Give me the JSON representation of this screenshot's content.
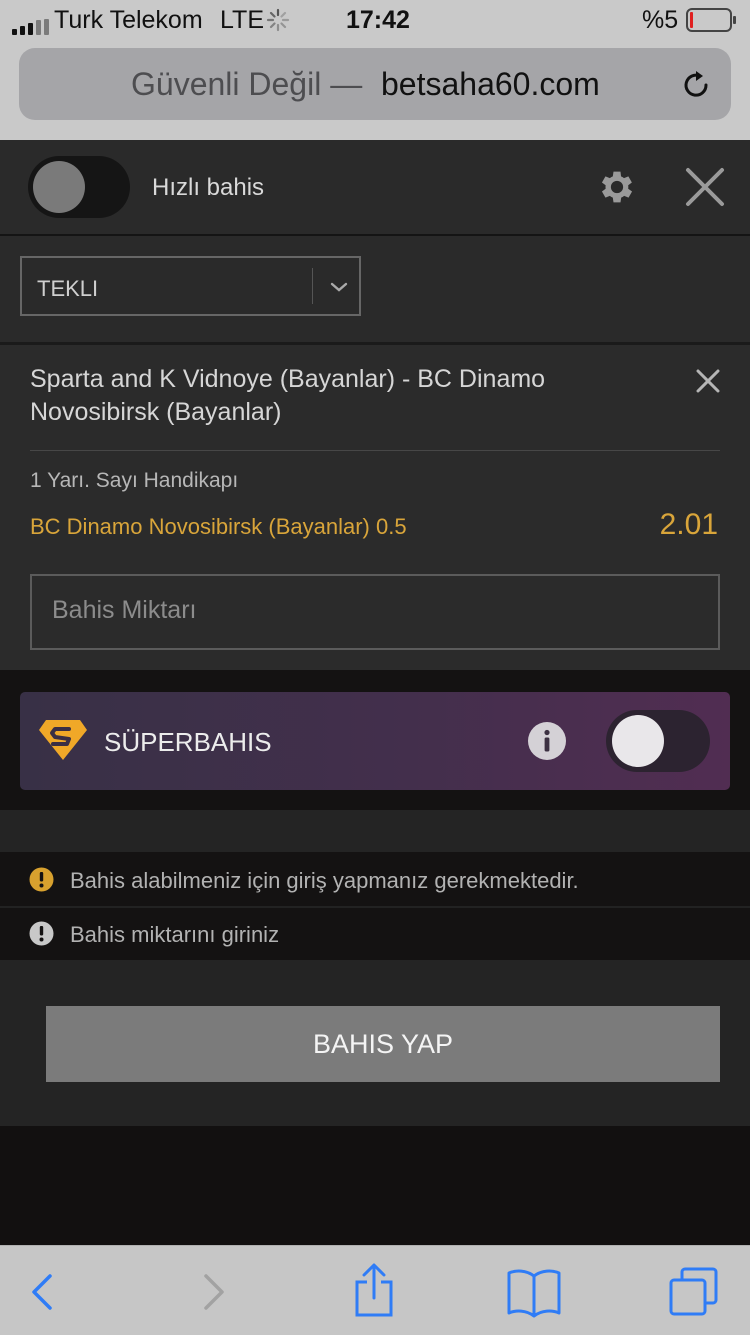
{
  "status_bar": {
    "carrier": "Turk Telekom",
    "network": "LTE",
    "time": "17:42",
    "battery": "%5"
  },
  "browser": {
    "security": "Güvenli Değil —",
    "domain": "betsaha60.com"
  },
  "header": {
    "quick_bet_label": "Hızlı bahis",
    "quick_bet_on": false
  },
  "bet_type": {
    "selected": "TEKLI"
  },
  "bet": {
    "match": "Sparta and K Vidnoye (Bayanlar) - BC Dinamo Novosibirsk (Bayanlar)",
    "market": "1 Yarı. Sayı Handikapı",
    "selection": "BC Dinamo Novosibirsk (Bayanlar) 0.5",
    "odds": "2.01",
    "amount_placeholder": "Bahis Miktarı"
  },
  "superbahis": {
    "label": "SÜPERBAHIS",
    "enabled": false
  },
  "messages": [
    "Bahis alabilmeniz için giriş yapmanız gerekmektedir.",
    "Bahis miktarını giriniz"
  ],
  "place_bet_label": "BAHIS YAP",
  "colors": {
    "accent_gold": "#d9a53a",
    "warning_yellow": "#d8a12e",
    "super_start": "#383046",
    "super_end": "#512d52",
    "ios_blue": "#2f7cf6"
  }
}
